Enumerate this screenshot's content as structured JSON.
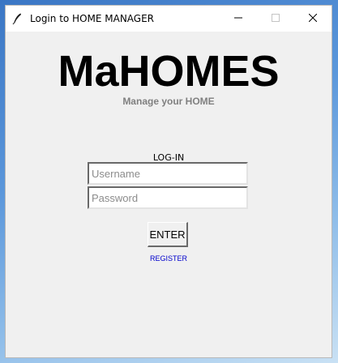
{
  "window": {
    "title": "Login to HOME MANAGER",
    "app_icon": "feather-icon",
    "controls": {
      "minimize_icon": "minimize-icon",
      "maximize_icon": "maximize-icon",
      "close_icon": "close-icon"
    }
  },
  "header": {
    "logo": "MaHOMES",
    "subtitle": "Manage your HOME"
  },
  "login_form": {
    "label": "LOG-IN",
    "username": {
      "value": "",
      "placeholder": "Username"
    },
    "password": {
      "value": "",
      "placeholder": "Password"
    },
    "enter_label": "ENTER",
    "register_label": "REGISTER"
  },
  "colors": {
    "window_background": "#f0f0f0",
    "subtitle": "#808080",
    "link": "#0000cc"
  }
}
